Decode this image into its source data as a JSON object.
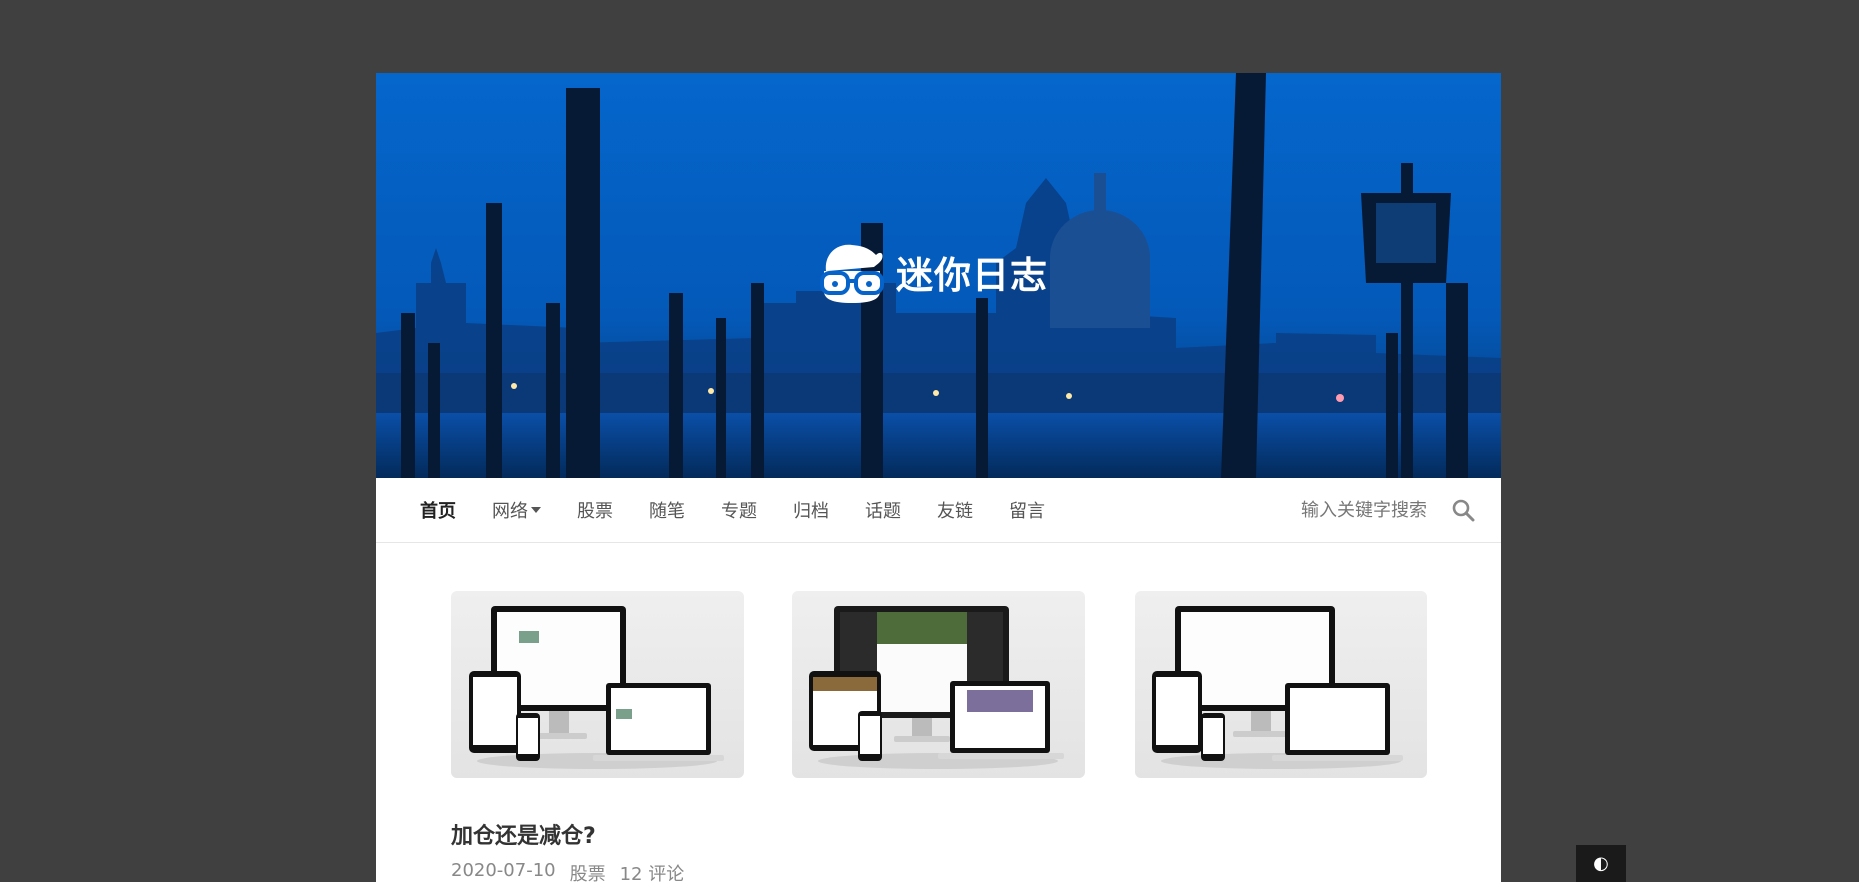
{
  "site": {
    "logo_text": "迷你日志"
  },
  "nav": {
    "items": [
      {
        "label": "首页",
        "active": true
      },
      {
        "label": "网络",
        "dropdown": true
      },
      {
        "label": "股票"
      },
      {
        "label": "随笔"
      },
      {
        "label": "专题"
      },
      {
        "label": "归档"
      },
      {
        "label": "话题"
      },
      {
        "label": "友链"
      },
      {
        "label": "留言"
      }
    ]
  },
  "search": {
    "placeholder": "输入关键字搜索",
    "icon": "search-icon"
  },
  "post": {
    "title": "加仓还是减仓?",
    "date": "2020-07-10",
    "category": "股票",
    "comments": "12 评论"
  },
  "theme_toggle": {
    "glyph": "◐",
    "icon": "half-circle-icon"
  },
  "colors": {
    "backdrop": "#404040",
    "banner_blue": "#0563c9",
    "page_bg": "#ffffff"
  }
}
